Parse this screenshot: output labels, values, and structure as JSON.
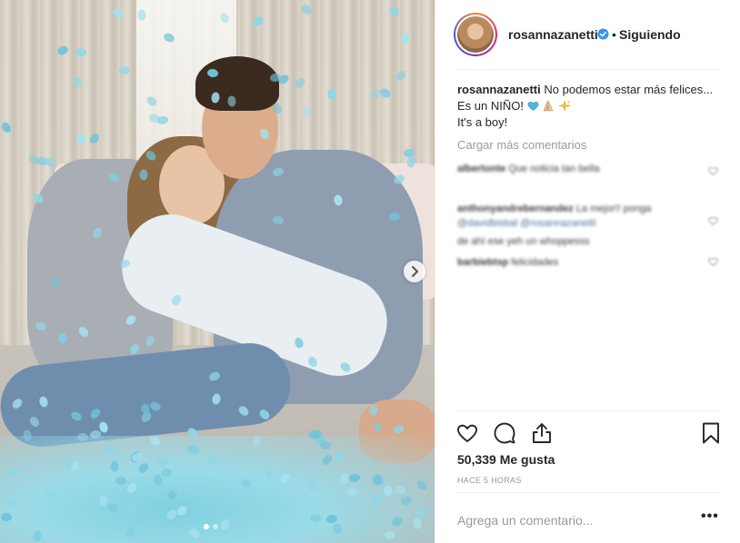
{
  "post": {
    "image_alt": "Couple sitting on floor surrounded by blue confetti",
    "carousel": {
      "slide_count": 2,
      "active_index": 0
    }
  },
  "header": {
    "username": "rosannazanetti",
    "verified": true,
    "separator": "•",
    "follow_status": "Siguiendo"
  },
  "caption": {
    "username": "rosannazanetti",
    "line1": "No podemos estar más felices... Es un NIÑO!",
    "line2": "It's a boy!"
  },
  "comments": {
    "load_more": "Cargar más comentarios",
    "items": [
      {
        "user": "albertonte",
        "text": "Que noticia tan bella"
      },
      {
        "user": "anthonyandrebernandez",
        "text": "La mejor!! ponga",
        "mentions": [
          "@davidbisbal",
          "@rosannazanetti"
        ]
      },
      {
        "user": "",
        "text": "de ahí ese yeh un whoppesss"
      },
      {
        "user": "barbiebtsp",
        "text": "felicidades"
      }
    ]
  },
  "actions": {
    "like_icon": "heart-outline-icon",
    "comment_icon": "comment-bubble-icon",
    "share_icon": "share-icon",
    "save_icon": "bookmark-icon"
  },
  "likes": "50,339 Me gusta",
  "timestamp": "HACE 5 HORAS",
  "add_comment": {
    "placeholder": "Agrega un comentario..."
  },
  "more_options": "•••",
  "colors": {
    "text": "#262626",
    "muted": "#999999",
    "verified": "#3897f0",
    "divider": "#efefef",
    "confetti": "#8fd6e8"
  }
}
